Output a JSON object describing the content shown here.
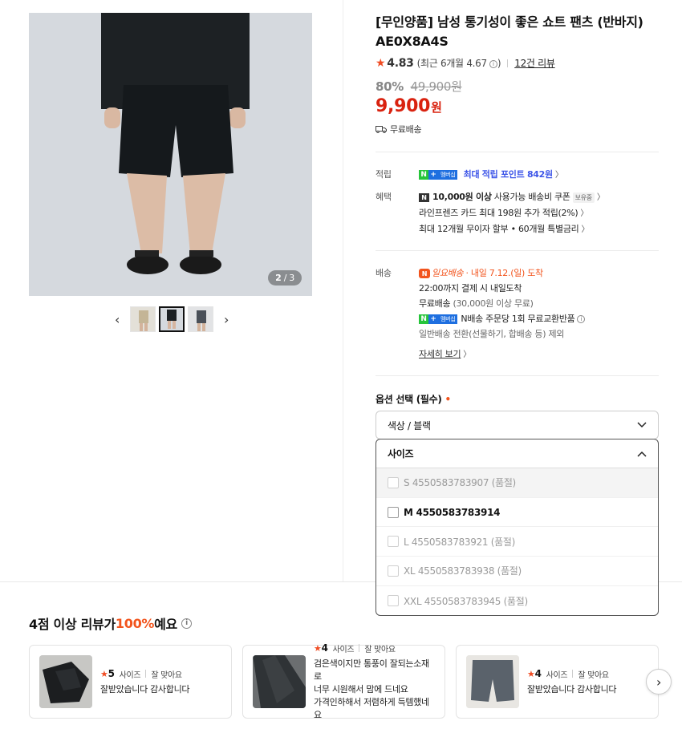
{
  "gallery": {
    "counter_current": "2",
    "counter_sep": "/",
    "counter_total": "3",
    "prev_icon": "‹",
    "next_icon": "›"
  },
  "product": {
    "title": "[무인양품] 남성 통기성이 좋은 쇼트 팬츠 (반바지) AE0X8A4S",
    "rating": "4.83",
    "rating_sub": "(최근 6개월 4.67",
    "rating_sub_end": ")",
    "review_count": "12건 리뷰",
    "discount_pct": "80%",
    "original_price": "49,900원",
    "price": "9,900",
    "price_unit": "원",
    "free_shipping": "무료배송"
  },
  "benefits": {
    "accrual_label": "적립",
    "accrual_badge_n": "N",
    "accrual_badge_plus": "+",
    "accrual_badge_member": "멤버십",
    "accrual_text": "최대 적립 포인트 842원",
    "benefit_label": "혜택",
    "coupon_n": "N",
    "coupon_bold": "10,000원 이상",
    "coupon_text": "사용가능 배송비 쿠폰",
    "coupon_tag": "보유중",
    "card_text": "라인프렌즈 카드 최대 198원 추가 적립(2%)",
    "installment_text": "최대 12개월 무이자 할부 • 60개월 특별금리"
  },
  "delivery": {
    "label": "배송",
    "sunday_icon": "N",
    "sunday_text": "일요배송",
    "arrival": "· 내일 7.12.(일) 도착",
    "cutoff": "22:00까지 결제 시 내일도착",
    "free_ship": "무료배송",
    "free_ship_cond": "(30,000원 이상 무료)",
    "nreturn_text": "N배송 주문당 1회 무료교환반품",
    "general_text": "일반배송 전환(선물하기, 합배송 등) 제외",
    "detail_link": "자세히 보기"
  },
  "options": {
    "title": "옵션 선택 (필수)",
    "required_mark": "•",
    "color_select": "색상 / 블랙",
    "size_header": "사이즈",
    "sizes": [
      "S 4550583783907 (품절)",
      "M 4550583783914",
      "L 4550583783921 (품절)",
      "XL 4550583783938 (품절)",
      "XXL 4550583783945 (품절)"
    ]
  },
  "reviews": {
    "heading_pre": "4점 이상 리뷰가 ",
    "heading_hl": "100%",
    "heading_post": "예요",
    "cards": [
      {
        "score": "5",
        "meta1": "사이즈",
        "meta2": "잘 맞아요",
        "text": "잘받았습니다 감사합니다"
      },
      {
        "score": "4",
        "meta1": "사이즈",
        "meta2": "잘 맞아요",
        "text": "검은색이지만 통풍이 잘되는소재로\n너무 시원해서 맘에 드네요\n가격인하해서 저렴하게 득템했네요"
      },
      {
        "score": "4",
        "meta1": "사이즈",
        "meta2": "잘 맞아요",
        "text": "잘받았습니다 감사합니다"
      }
    ],
    "next_icon": "›"
  },
  "colors": {
    "price_red": "#d9220f",
    "accent_orange": "#f2541d",
    "point_blue": "#3d55e8",
    "npay_green": "#27c53b"
  }
}
